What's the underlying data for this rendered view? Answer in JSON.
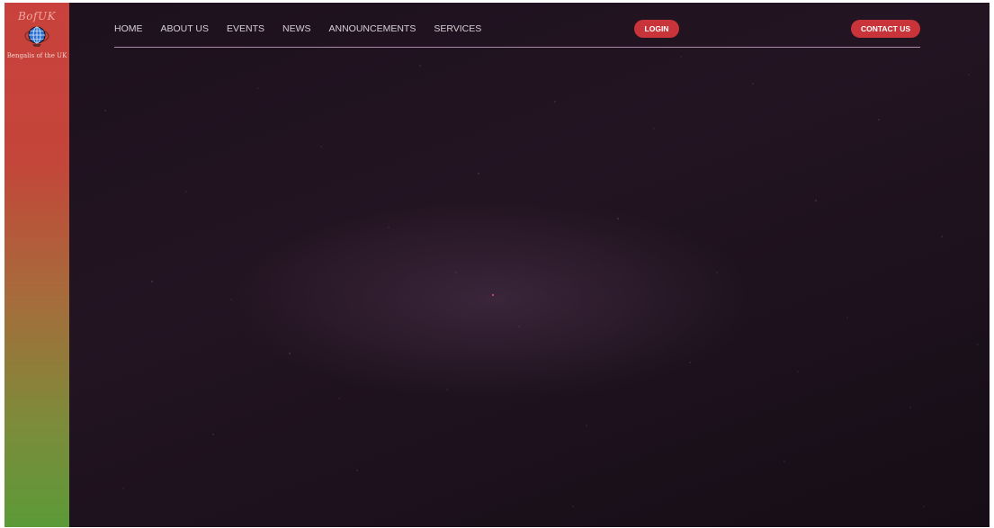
{
  "sidebar": {
    "logo_top": "BofUK",
    "logo_bottom": "Bengalis of the UK",
    "globe_icon": "globe-icon"
  },
  "nav": {
    "links": [
      "HOME",
      "ABOUT US",
      "EVENTS",
      "NEWS",
      "ANNOUNCEMENTS",
      "SERVICES"
    ],
    "login_label": "LOGIN",
    "contact_label": "CONTACT US"
  },
  "colors": {
    "sidebar_top": "#c9413c",
    "sidebar_bottom": "#5c9a38",
    "hero_bg": "#1d111d",
    "button_red": "#c9343a",
    "nav_text": "#d7cfd6"
  }
}
